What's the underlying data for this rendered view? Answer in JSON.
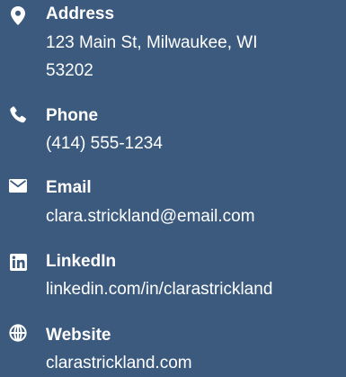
{
  "contacts": {
    "address": {
      "icon": "map-marker-icon",
      "label": "Address",
      "line1": "123 Main St, Milwaukee, WI",
      "line2": "53202"
    },
    "phone": {
      "icon": "phone-icon",
      "label": "Phone",
      "value": "(414) 555-1234"
    },
    "email": {
      "icon": "envelope-icon",
      "label": "Email",
      "value": "clara.strickland@email.com"
    },
    "linkedin": {
      "icon": "linkedin-icon",
      "label": "LinkedIn",
      "value": "linkedin.com/in/clarastrickland"
    },
    "website": {
      "icon": "globe-icon",
      "label": "Website",
      "value": "clarastrickland.com"
    }
  },
  "colors": {
    "background": "#3b5a7e",
    "text": "#ffffff"
  }
}
